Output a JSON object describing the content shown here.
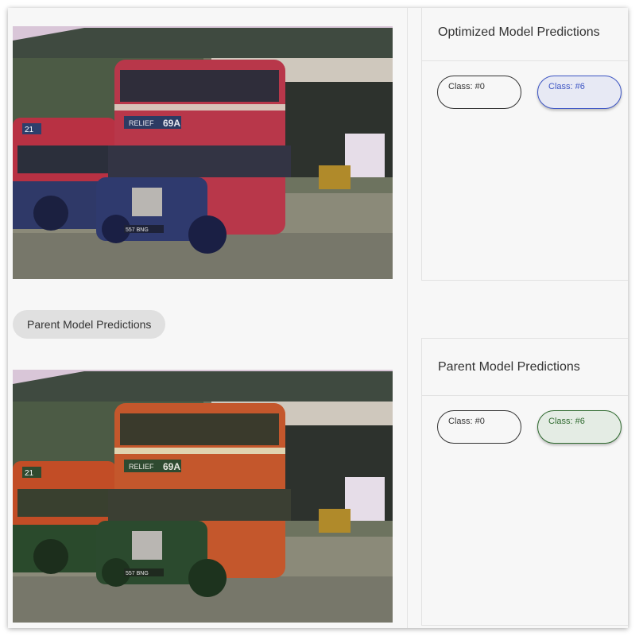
{
  "optimized_panel": {
    "title": "Optimized Model Predictions",
    "classes": [
      "Class: #0",
      "Class: #6"
    ],
    "selected_class": "Class: #6",
    "selected_color": "#3e56c4"
  },
  "parent_section": {
    "chip_label": "Parent Model Predictions"
  },
  "parent_panel": {
    "title": "Parent Model Predictions",
    "classes": [
      "Class: #0",
      "Class: #6"
    ],
    "selected_class": "Class: #6",
    "selected_color": "#2f6a2f"
  },
  "images": {
    "top": {
      "bus_sign": "RELIEF",
      "route": "69A",
      "plate": "557 BNG",
      "rear_route": "21",
      "highlight_color": "#c0364b"
    },
    "bottom": {
      "bus_sign": "RELIEF",
      "route": "69A",
      "plate": "557 BNG",
      "rear_route": "21",
      "highlight_color": "#c5522a"
    }
  }
}
